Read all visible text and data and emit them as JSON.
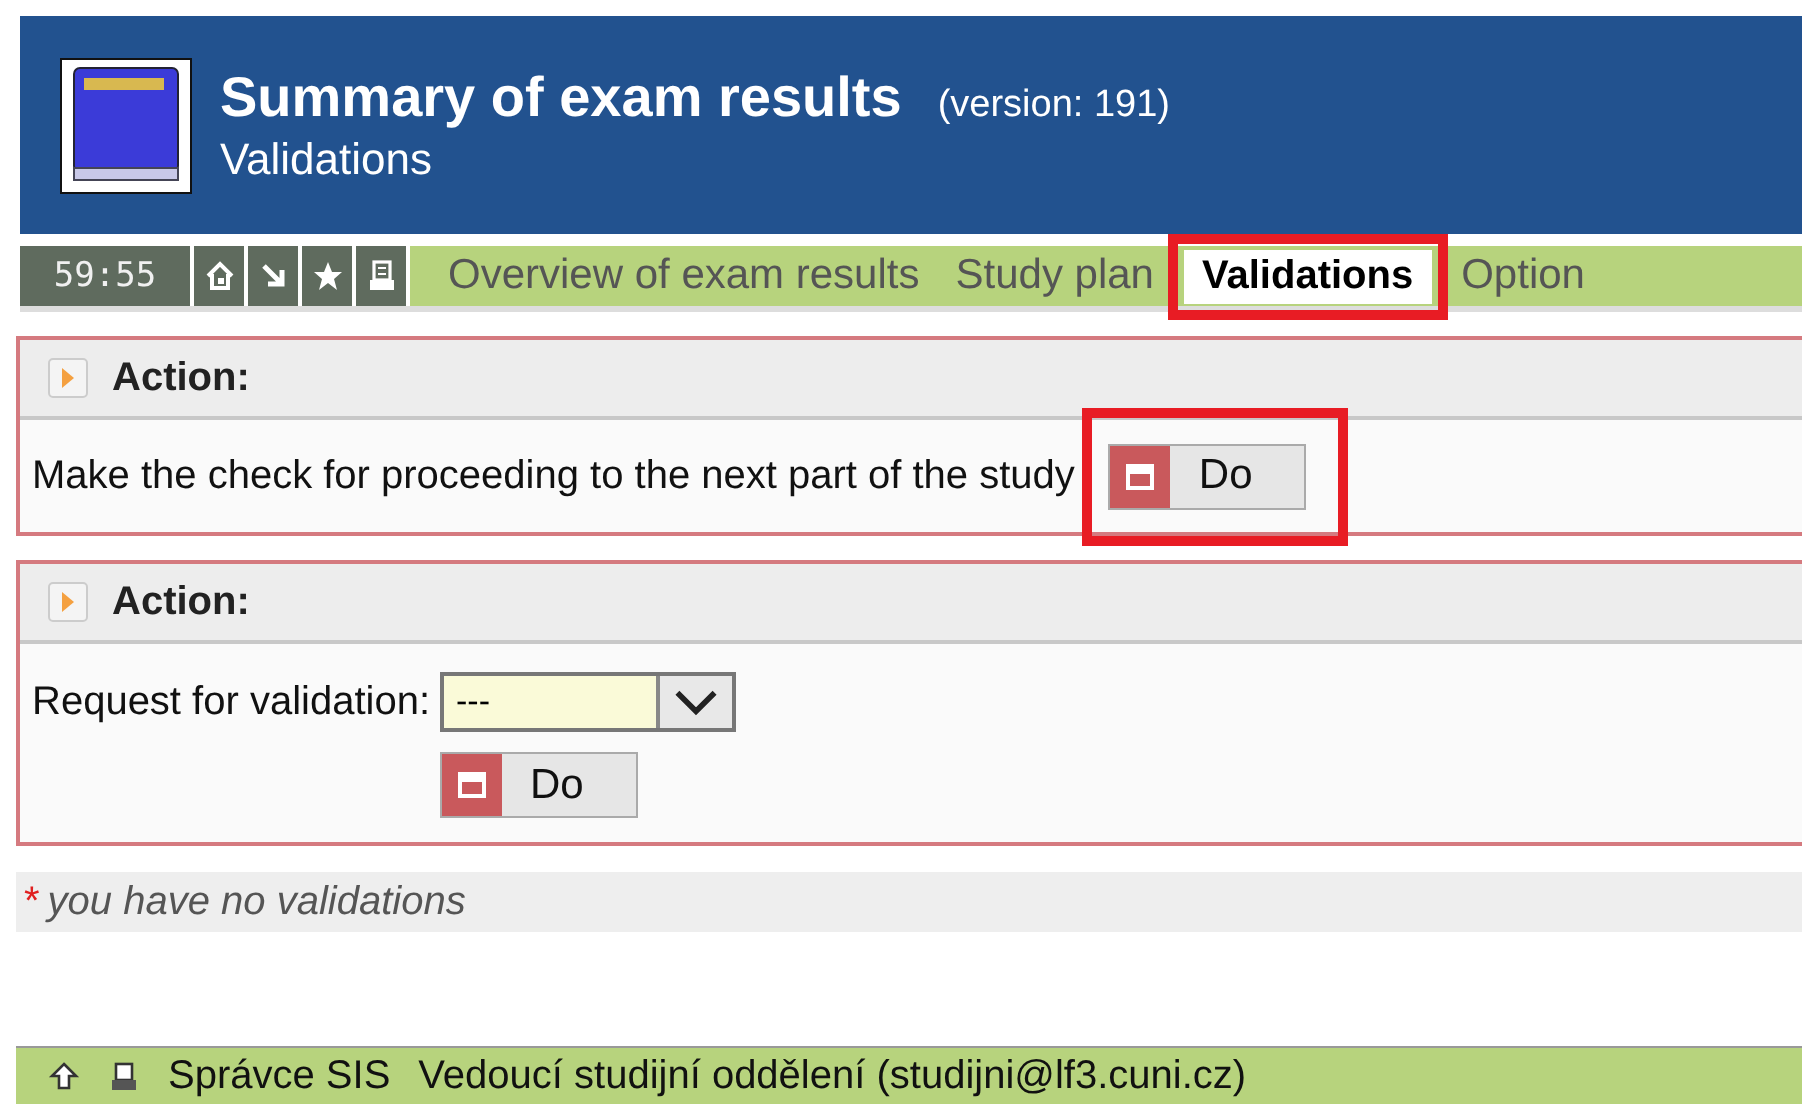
{
  "header": {
    "title": "Summary of exam results",
    "version": "(version: 191)",
    "subtitle": "Validations"
  },
  "nav": {
    "timer": "59:55",
    "tabs": [
      {
        "label": "Overview of exam results",
        "selected": false,
        "highlighted": false
      },
      {
        "label": "Study plan",
        "selected": false,
        "highlighted": false
      },
      {
        "label": "Validations",
        "selected": true,
        "highlighted": true
      },
      {
        "label": "Option",
        "selected": false,
        "highlighted": false
      }
    ]
  },
  "panels": [
    {
      "title": "Action:",
      "kind": "text",
      "text": "Make the check for proceeding to the next part of the study",
      "button": {
        "label": "Do",
        "highlighted": true
      }
    },
    {
      "title": "Action:",
      "kind": "select",
      "label": "Request for validation:",
      "value": "---",
      "button": {
        "label": "Do",
        "highlighted": false
      }
    }
  ],
  "note": {
    "mark": "*",
    "text": "you have no validations"
  },
  "footer": {
    "items": [
      "Správce SIS",
      "Vedoucí studijní oddělení (studijni@lf3.cuni.cz)"
    ]
  }
}
